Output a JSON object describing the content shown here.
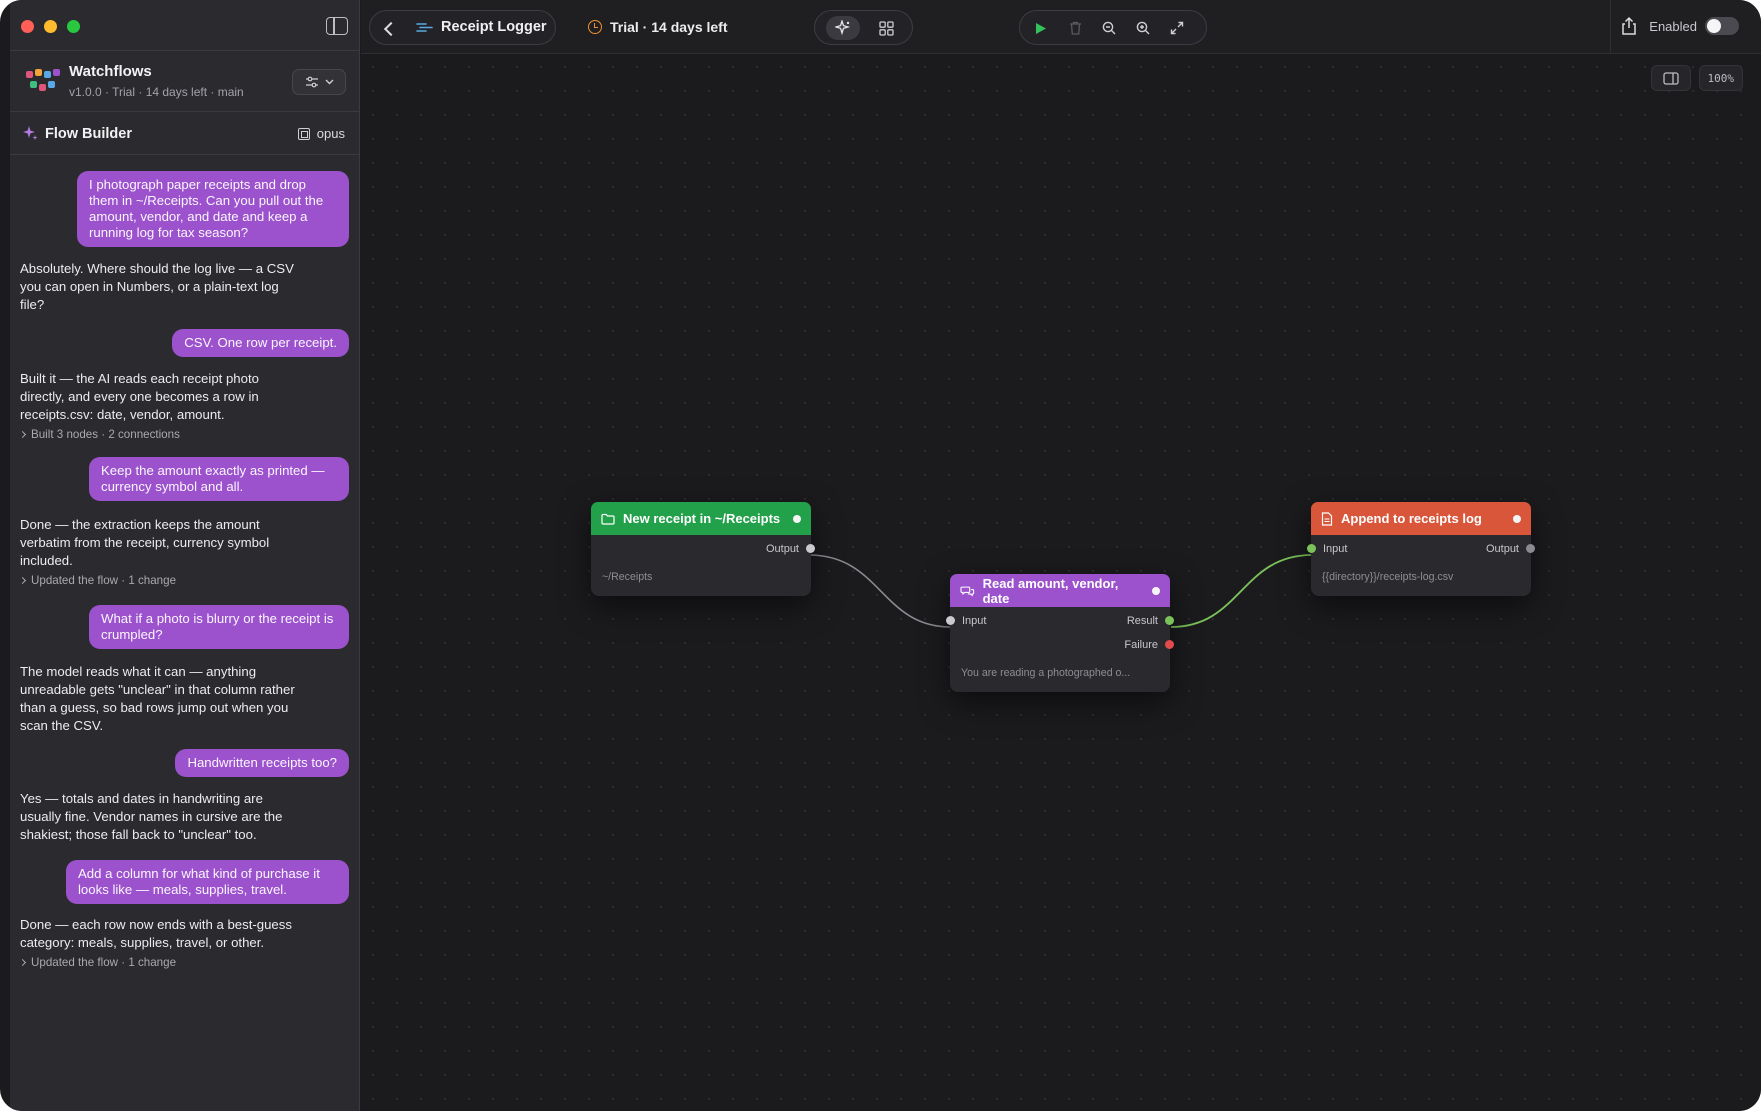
{
  "window": {
    "title": "Receipt Logger"
  },
  "app": {
    "name": "Watchflows",
    "meta": "v1.0.0 · Trial · 14 days left · main"
  },
  "builder": {
    "title": "Flow Builder",
    "model": "opus"
  },
  "chat": [
    {
      "role": "user",
      "text": "I photograph paper receipts and drop them in ~/Receipts. Can you pull out the amount, vendor, and date and keep a running log for tax season?"
    },
    {
      "role": "assistant",
      "text": "Absolutely. Where should the log live — a CSV you can open in Numbers, or a plain-text log file?"
    },
    {
      "role": "user",
      "text": "CSV. One row per receipt."
    },
    {
      "role": "assistant",
      "text": "Built it — the AI reads each receipt photo directly, and every one becomes a row in receipts.csv: date, vendor, amount.",
      "status": "Built 3 nodes · 2 connections"
    },
    {
      "role": "user",
      "text": "Keep the amount exactly as printed — currency symbol and all."
    },
    {
      "role": "assistant",
      "text": "Done — the extraction keeps the amount verbatim from the receipt, currency symbol included.",
      "status": "Updated the flow · 1 change"
    },
    {
      "role": "user",
      "text": "What if a photo is blurry or the receipt is crumpled?"
    },
    {
      "role": "assistant",
      "text": "The model reads what it can — anything unreadable gets \"unclear\" in that column rather than a guess, so bad rows jump out when you scan the CSV."
    },
    {
      "role": "user",
      "text": "Handwritten receipts too?"
    },
    {
      "role": "assistant",
      "text": "Yes — totals and dates in handwriting are usually fine. Vendor names in cursive are the shakiest; those fall back to \"unclear\" too."
    },
    {
      "role": "user",
      "text": "Add a column for what kind of purchase it looks like — meals, supplies, travel."
    },
    {
      "role": "assistant",
      "text": "Done — each row now ends with a best-guess category: meals, supplies, travel, or other.",
      "status": "Updated the flow · 1 change"
    }
  ],
  "topbar": {
    "flow_title": "Receipt Logger",
    "trial": "Trial · 14 days left",
    "enabled_label": "Enabled",
    "enabled": false
  },
  "canvas": {
    "zoom": "100%"
  },
  "nodes": {
    "trigger": {
      "title": "New receipt in ~/Receipts",
      "output": "Output",
      "sub": "~/Receipts",
      "color": "#22a04a"
    },
    "ai": {
      "title": "Read amount, vendor, date",
      "input": "Input",
      "result": "Result",
      "failure": "Failure",
      "sub": "You are reading a photographed o...",
      "color": "#9b52cc"
    },
    "append": {
      "title": "Append to receipts log",
      "input": "Input",
      "output": "Output",
      "sub": "{{directory}}/receipts-log.csv",
      "color": "#d9563a"
    }
  },
  "colors": {
    "accent": "#9b52cc",
    "success": "#7bc25a",
    "danger": "#e24b4b"
  }
}
